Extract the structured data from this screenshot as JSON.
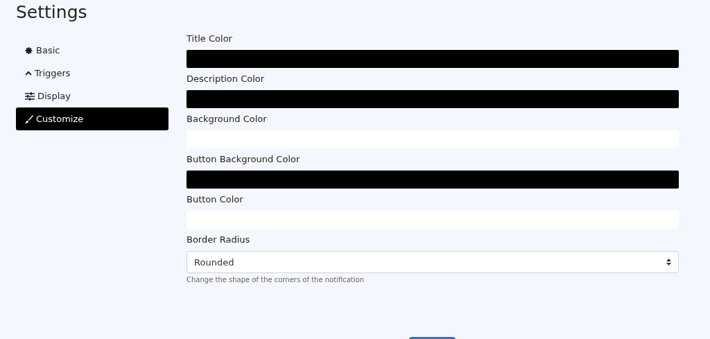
{
  "page": {
    "title": "Settings"
  },
  "sidebar": {
    "items": [
      {
        "label": "Basic",
        "selected": false
      },
      {
        "label": "Triggers",
        "selected": false
      },
      {
        "label": "Display",
        "selected": false
      },
      {
        "label": "Customize",
        "selected": true
      }
    ]
  },
  "fields": [
    {
      "label": "Title Color",
      "kind": "color",
      "color": "#000000"
    },
    {
      "label": "Description Color",
      "kind": "color",
      "color": "#000000"
    },
    {
      "label": "Background Color",
      "kind": "color",
      "color": "#ffffff"
    },
    {
      "label": "Button Background Color",
      "kind": "color",
      "color": "#000000"
    },
    {
      "label": "Button Color",
      "kind": "color",
      "color": "#ffffff"
    },
    {
      "label": "Border Radius",
      "kind": "select",
      "value": "Rounded",
      "help": "Change the shape of the corners of the notification"
    }
  ],
  "footer": {
    "button": {
      "kind": "primary"
    }
  }
}
